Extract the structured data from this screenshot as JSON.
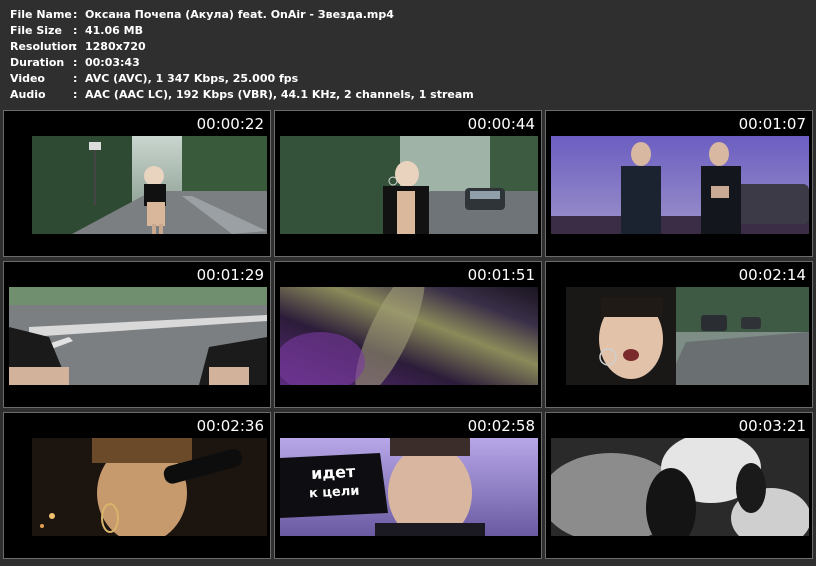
{
  "info": {
    "rows": [
      {
        "key": "File Name",
        "value": "Оксана Почепа (Акула) feat. OnAir - Звезда.mp4"
      },
      {
        "key": "File Size",
        "value": "41.06 MB"
      },
      {
        "key": "Resolution",
        "value": "1280x720"
      },
      {
        "key": "Duration",
        "value": "00:03:43"
      },
      {
        "key": "Video",
        "value": "AVC (AVC), 1 347 Kbps, 25.000 fps"
      },
      {
        "key": "Audio",
        "value": "AAC (AAC LC), 192 Kbps (VBR), 44.1 KHz, 2 channels, 1 stream"
      }
    ],
    "colon": ":"
  },
  "thumbs": [
    {
      "time": "00:00:22",
      "scene": "forest-road-woman"
    },
    {
      "time": "00:00:44",
      "scene": "forest-road-car"
    },
    {
      "time": "00:01:07",
      "scene": "two-men-dusk"
    },
    {
      "time": "00:01:29",
      "scene": "hands-road"
    },
    {
      "time": "00:01:51",
      "scene": "light-blur"
    },
    {
      "time": "00:02:14",
      "scene": "woman-closeup-road"
    },
    {
      "time": "00:02:36",
      "scene": "woman-microphone"
    },
    {
      "time": "00:02:58",
      "scene": "man-closeup-caption"
    },
    {
      "time": "00:03:21",
      "scene": "monochrome-blur"
    }
  ],
  "captions": {
    "line1": "идет",
    "line2": "к цели"
  }
}
